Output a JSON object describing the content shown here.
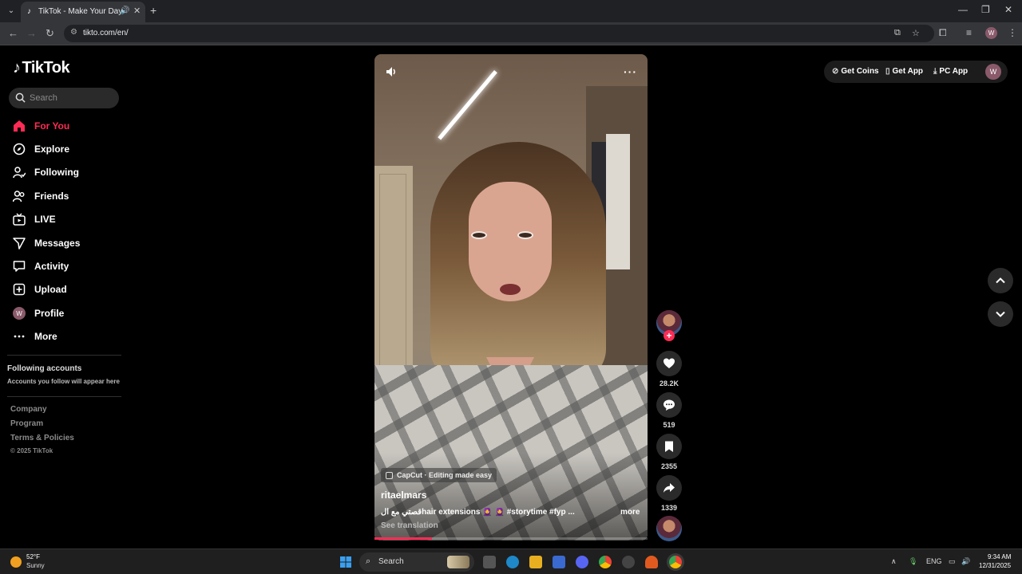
{
  "browser": {
    "tab_title": "TikTok - Make Your Day",
    "url": "tikto.com/en/",
    "profile_initial": "W"
  },
  "sidebar": {
    "logo": "TikTok",
    "search_placeholder": "Search",
    "nav": [
      {
        "label": "For You",
        "icon": "home-icon",
        "active": true
      },
      {
        "label": "Explore",
        "icon": "compass-icon"
      },
      {
        "label": "Following",
        "icon": "following-icon"
      },
      {
        "label": "Friends",
        "icon": "friends-icon"
      },
      {
        "label": "LIVE",
        "icon": "live-icon"
      },
      {
        "label": "Messages",
        "icon": "messages-icon"
      },
      {
        "label": "Activity",
        "icon": "activity-icon"
      },
      {
        "label": "Upload",
        "icon": "upload-icon"
      },
      {
        "label": "Profile",
        "icon": "profile-avatar",
        "initial": "W"
      },
      {
        "label": "More",
        "icon": "more-icon"
      }
    ],
    "following_title": "Following accounts",
    "following_sub": "Accounts you follow will appear here",
    "footer": [
      "Company",
      "Program",
      "Terms & Policies"
    ],
    "copyright": "© 2025 TikTok"
  },
  "video": {
    "effect_label": "CapCut · Editing made easy",
    "author": "ritaelmars",
    "caption": "قصتي مع الhair extensions 🧕 🧕 #storytime #fyp ...",
    "more": "more",
    "see_translation": "See translation",
    "progress": 0.21
  },
  "actions": {
    "likes": "28.2K",
    "comments": "519",
    "saves": "2355",
    "shares": "1339"
  },
  "topbar": {
    "get_coins": "Get Coins",
    "get_app": "Get App",
    "pc_app": "PC App",
    "avatar_initial": "W"
  },
  "taskbar": {
    "temp": "52°F",
    "condition": "Sunny",
    "search": "Search",
    "lang": "ENG",
    "time": "9:34 AM",
    "date": "12/31/2025"
  },
  "colors": {
    "accent": "#fe2c55",
    "background": "#000000"
  }
}
